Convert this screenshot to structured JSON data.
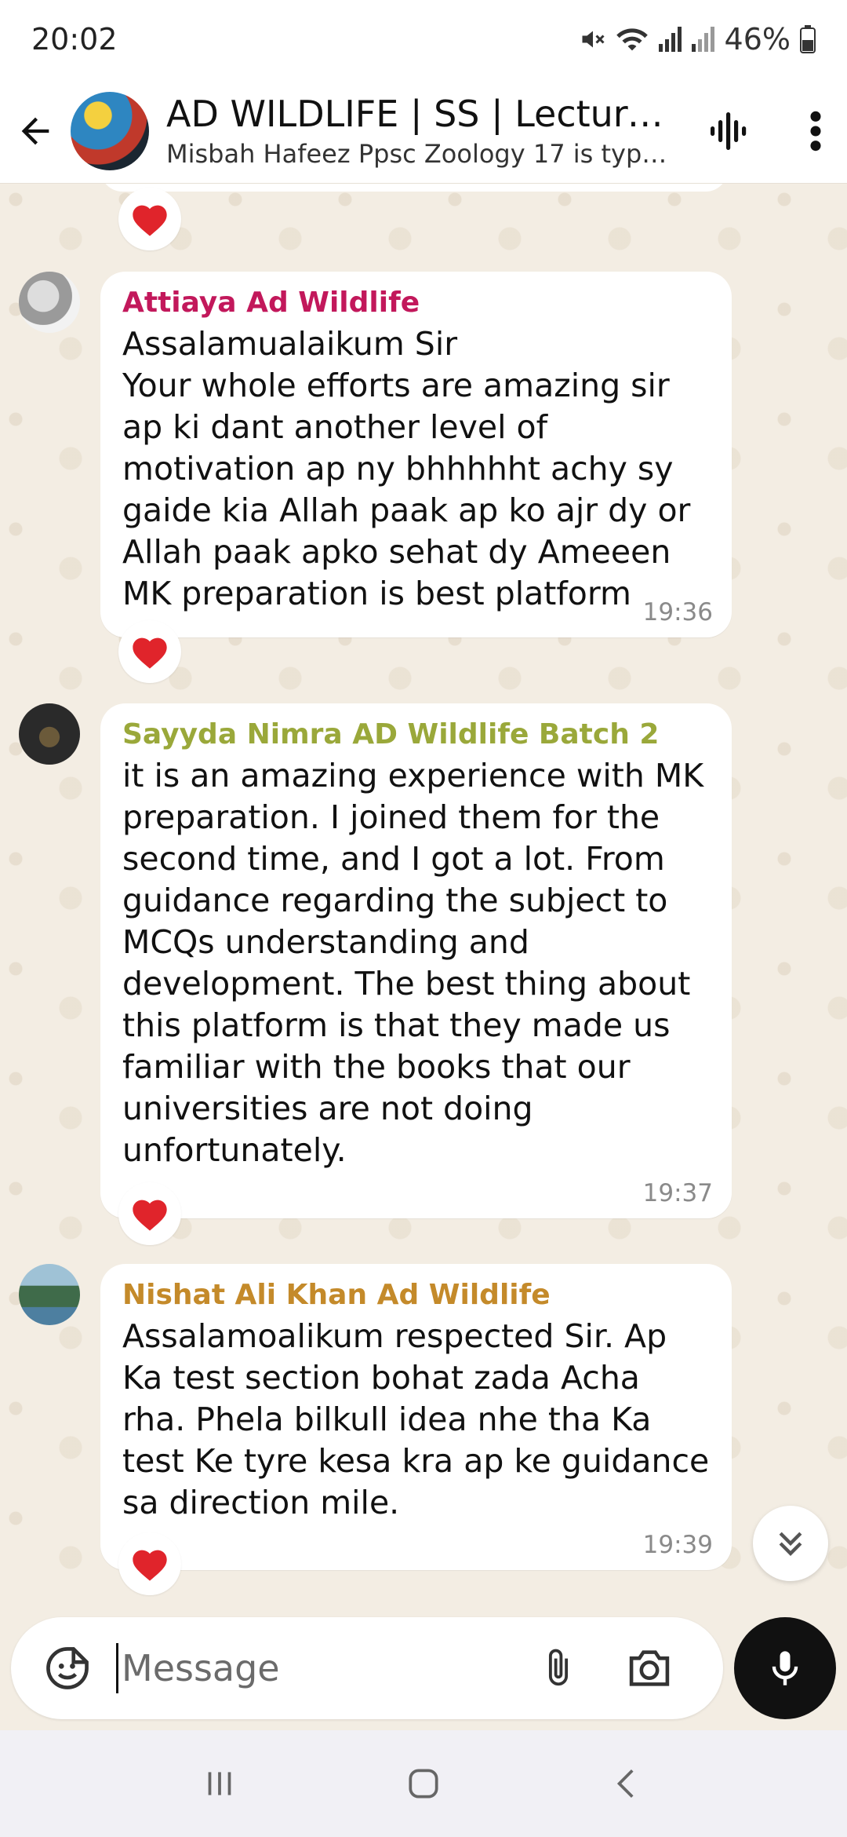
{
  "status_bar": {
    "time": "20:02",
    "battery": "46%"
  },
  "header": {
    "title": "AD WILDLIFE | SS | Lecturer...",
    "subtitle": "Misbah Hafeez Ppsc Zoology 17 is typi..."
  },
  "messages": [
    {
      "sender": "Attiaya Ad Wildlife",
      "sender_color": "#c2185b",
      "text": "Assalamualaikum Sir\nYour whole efforts are amazing sir ap ki dant another level of motivation ap ny bhhhhht achy sy gaide kia Allah paak ap ko ajr dy or Allah paak apko sehat dy Ameeen MK preparation is best platform",
      "time": "19:36"
    },
    {
      "sender": "Sayyda Nimra AD Wildlife Batch 2",
      "sender_color": "#9aa83a",
      "text": "it is an amazing experience with MK preparation. I joined them for the second time, and I got a lot. From guidance regarding the subject to MCQs understanding and development. The best thing about this platform is that they made us familiar with the books that our universities are not doing unfortunately.",
      "time": "19:37"
    },
    {
      "sender": "Nishat Ali Khan Ad Wildlife",
      "sender_color": "#c48a2a",
      "text": "Assalamoalikum respected Sir. Ap Ka test section bohat zada Acha rha. Phela bilkull idea nhe tha Ka test Ke tyre kesa kra ap ke guidance sa direction mile.",
      "time": "19:39"
    }
  ],
  "composer": {
    "placeholder": "Message"
  },
  "colors": {
    "heart": "#e0242b",
    "chat_background": "#f3ede3"
  }
}
